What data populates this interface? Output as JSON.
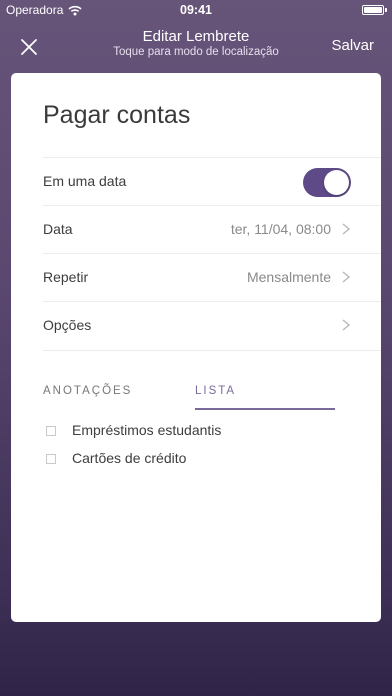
{
  "status_bar": {
    "carrier": "Operadora",
    "time": "09:41",
    "icons": {
      "wifi": "wifi-icon",
      "battery": "battery-icon"
    }
  },
  "nav": {
    "close_icon": "close-icon",
    "title": "Editar Lembrete",
    "subtitle": "Toque para modo de localização",
    "save_label": "Salvar"
  },
  "reminder": {
    "title": "Pagar contas",
    "rows": [
      {
        "label": "Em uma data",
        "toggle_on": true
      },
      {
        "label": "Data",
        "value": "ter, 11/04, 08:00"
      },
      {
        "label": "Repetir",
        "value": "Mensalmente"
      },
      {
        "label": "Opções",
        "value": ""
      }
    ],
    "tabs": [
      {
        "label": "ANOTAÇÕES",
        "selected": false
      },
      {
        "label": "LISTA",
        "selected": true
      }
    ],
    "list_items": [
      {
        "text": "Empréstimos estudantis",
        "checked": false
      },
      {
        "text": "Cartões de crédito",
        "checked": false
      }
    ]
  },
  "colors": {
    "accent": "#5e4a86",
    "background_top": "#665479",
    "background_bottom": "#2f2447"
  }
}
